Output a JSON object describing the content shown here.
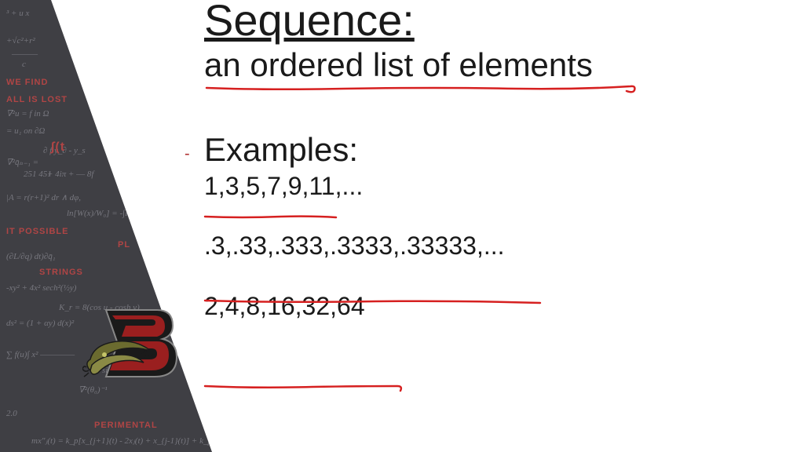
{
  "slide": {
    "title": "Sequence:",
    "subtitle": "an ordered list of elements",
    "examples_label": "Examples:",
    "example1": "1,3,5,7,9,11,...",
    "example2": ".3,.33,.333,.3333,.33333,...",
    "example3": "2,4,8,16,32,64"
  },
  "colors": {
    "annotation": "#d62020",
    "text": "#1a1a1a",
    "bg_dark": "#3a3a3e",
    "bg_accent": "#a03838"
  }
}
